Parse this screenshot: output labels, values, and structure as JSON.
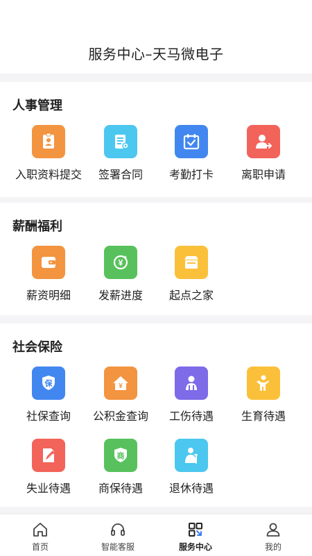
{
  "header": {
    "title": "服务中心–天马微电子"
  },
  "sections": [
    {
      "title": "人事管理",
      "items": [
        {
          "label": "入职资料提交",
          "icon": "badge-icon",
          "color": "#f39440"
        },
        {
          "label": "签署合同",
          "icon": "contract-icon",
          "color": "#4cc7ef"
        },
        {
          "label": "考勤打卡",
          "icon": "calendar-check-icon",
          "color": "#4287ef"
        },
        {
          "label": "离职申请",
          "icon": "user-exit-icon",
          "color": "#f2635a"
        }
      ]
    },
    {
      "title": "薪酬福利",
      "items": [
        {
          "label": "薪资明细",
          "icon": "wallet-icon",
          "color": "#f39440"
        },
        {
          "label": "发薪进度",
          "icon": "yen-refresh-icon",
          "color": "#58c15d"
        },
        {
          "label": "起点之家",
          "icon": "store-icon",
          "color": "#fbc03a"
        }
      ]
    },
    {
      "title": "社会保险",
      "items": [
        {
          "label": "社保查询",
          "icon": "shield-bao-icon",
          "color": "#4287ef"
        },
        {
          "label": "公积金查询",
          "icon": "house-yen-icon",
          "color": "#f39440"
        },
        {
          "label": "工伤待遇",
          "icon": "injury-icon",
          "color": "#7d6be8"
        },
        {
          "label": "生育待遇",
          "icon": "child-icon",
          "color": "#fbc03a"
        },
        {
          "label": "失业待遇",
          "icon": "document-edit-icon",
          "color": "#f2635a"
        },
        {
          "label": "商保待遇",
          "icon": "shield-shang-icon",
          "color": "#58c15d"
        },
        {
          "label": "退休待遇",
          "icon": "elder-icon",
          "color": "#4cc7ef"
        }
      ]
    }
  ],
  "icon_text": {
    "yen": "¥",
    "bao": "保",
    "shang": "商"
  },
  "tabbar": {
    "tabs": [
      {
        "label": "首页",
        "icon": "home-icon"
      },
      {
        "label": "智能客服",
        "icon": "headset-icon"
      },
      {
        "label": "服务中心",
        "icon": "service-grid-icon",
        "active": true
      },
      {
        "label": "我的",
        "icon": "user-icon"
      }
    ]
  }
}
